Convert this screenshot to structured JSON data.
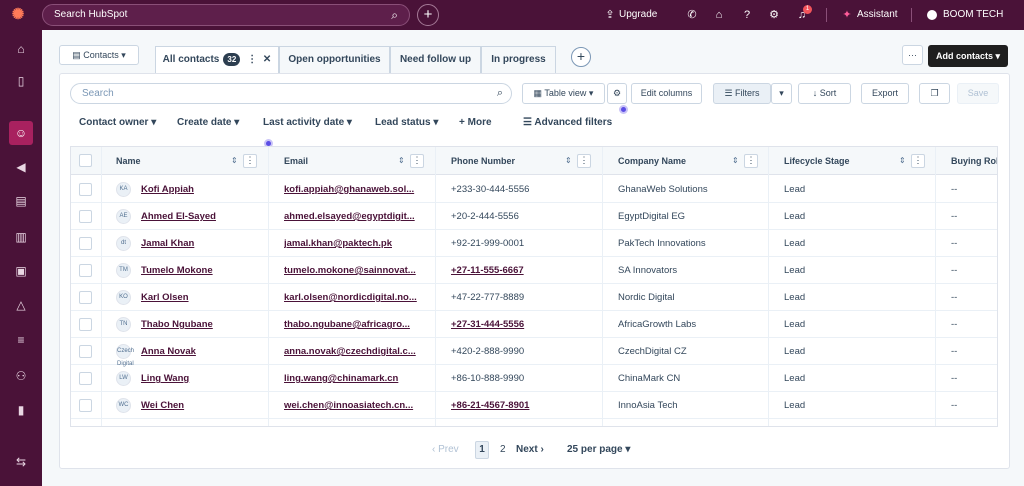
{
  "topbar": {
    "logo_icon": "hubspot-sprocket-icon",
    "search_placeholder": "Search HubSpot",
    "upgrade_label": "Upgrade",
    "notification_count": "1",
    "assistant_label": "Assistant",
    "account_name": "BOOM TECH"
  },
  "rail": {
    "items": [
      "home-icon",
      "bookmark-icon",
      "contacts-icon",
      "marketing-icon",
      "content-icon",
      "commerce-icon",
      "sales-icon",
      "service-icon",
      "data-icon",
      "automation-icon",
      "reporting-icon",
      "expand-icon"
    ]
  },
  "header": {
    "object_dropdown": "Contacts",
    "tabs": [
      {
        "label": "All contacts",
        "count": "32"
      },
      {
        "label": "Open opportunities"
      },
      {
        "label": "Need follow up"
      },
      {
        "label": "In progress"
      }
    ],
    "more_label": "···",
    "add_contacts_label": "Add contacts"
  },
  "toolbar": {
    "search_placeholder": "Search",
    "table_view_label": "Table view",
    "edit_columns_label": "Edit columns",
    "filters_label": "Filters",
    "sort_label": "Sort",
    "export_label": "Export",
    "save_label": "Save"
  },
  "filters": {
    "contact_owner": "Contact owner",
    "create_date": "Create date",
    "last_activity_date": "Last activity date",
    "lead_status": "Lead status",
    "more": "More",
    "advanced": "Advanced filters"
  },
  "table": {
    "columns": [
      "Name",
      "Email",
      "Phone Number",
      "Company Name",
      "Lifecycle Stage",
      "Buying Role"
    ],
    "rows": [
      {
        "initials": "KA",
        "name": "Kofi Appiah",
        "email": "kofi.appiah@ghanaweb.sol...",
        "phone": "+233-30-444-5556",
        "phone_link": false,
        "company": "GhanaWeb Solutions",
        "stage": "Lead",
        "role": "--"
      },
      {
        "initials": "AE",
        "name": "Ahmed El-Sayed",
        "email": "ahmed.elsayed@egyptdigit...",
        "phone": "+20-2-444-5556",
        "phone_link": false,
        "company": "EgyptDigital EG",
        "stage": "Lead",
        "role": "--"
      },
      {
        "initials": "dt",
        "name": "Jamal Khan",
        "email": "jamal.khan@paktech.pk",
        "phone": "+92-21-999-0001",
        "phone_link": false,
        "company": "PakTech Innovations",
        "stage": "Lead",
        "role": "--"
      },
      {
        "initials": "TM",
        "name": "Tumelo Mokone",
        "email": "tumelo.mokone@sainnovat...",
        "phone": "+27-11-555-6667",
        "phone_link": true,
        "company": "SA Innovators",
        "stage": "Lead",
        "role": "--"
      },
      {
        "initials": "KO",
        "name": "Karl Olsen",
        "email": "karl.olsen@nordicdigital.no...",
        "phone": "+47-22-777-8889",
        "phone_link": false,
        "company": "Nordic Digital",
        "stage": "Lead",
        "role": "--"
      },
      {
        "initials": "TN",
        "name": "Thabo Ngubane",
        "email": "thabo.ngubane@africagro...",
        "phone": "+27-31-444-5556",
        "phone_link": true,
        "company": "AfricaGrowth Labs",
        "stage": "Lead",
        "role": "--"
      },
      {
        "initials": "Czech Digital",
        "name": "Anna Novak",
        "email": "anna.novak@czechdigital.c...",
        "phone": "+420-2-888-9990",
        "phone_link": false,
        "company": "CzechDigital CZ",
        "stage": "Lead",
        "role": "--"
      },
      {
        "initials": "LW",
        "name": "Ling Wang",
        "email": "ling.wang@chinamark.cn",
        "phone": "+86-10-888-9990",
        "phone_link": false,
        "company": "ChinaMark CN",
        "stage": "Lead",
        "role": "--"
      },
      {
        "initials": "WC",
        "name": "Wei Chen",
        "email": "wei.chen@innoasiatech.cn...",
        "phone": "+86-21-4567-8901",
        "phone_link": true,
        "company": "InnoAsia Tech",
        "stage": "Lead",
        "role": "--"
      }
    ]
  },
  "pagination": {
    "prev": "Prev",
    "current": "1",
    "next_page": "2",
    "next": "Next",
    "per_page": "25 per page"
  }
}
